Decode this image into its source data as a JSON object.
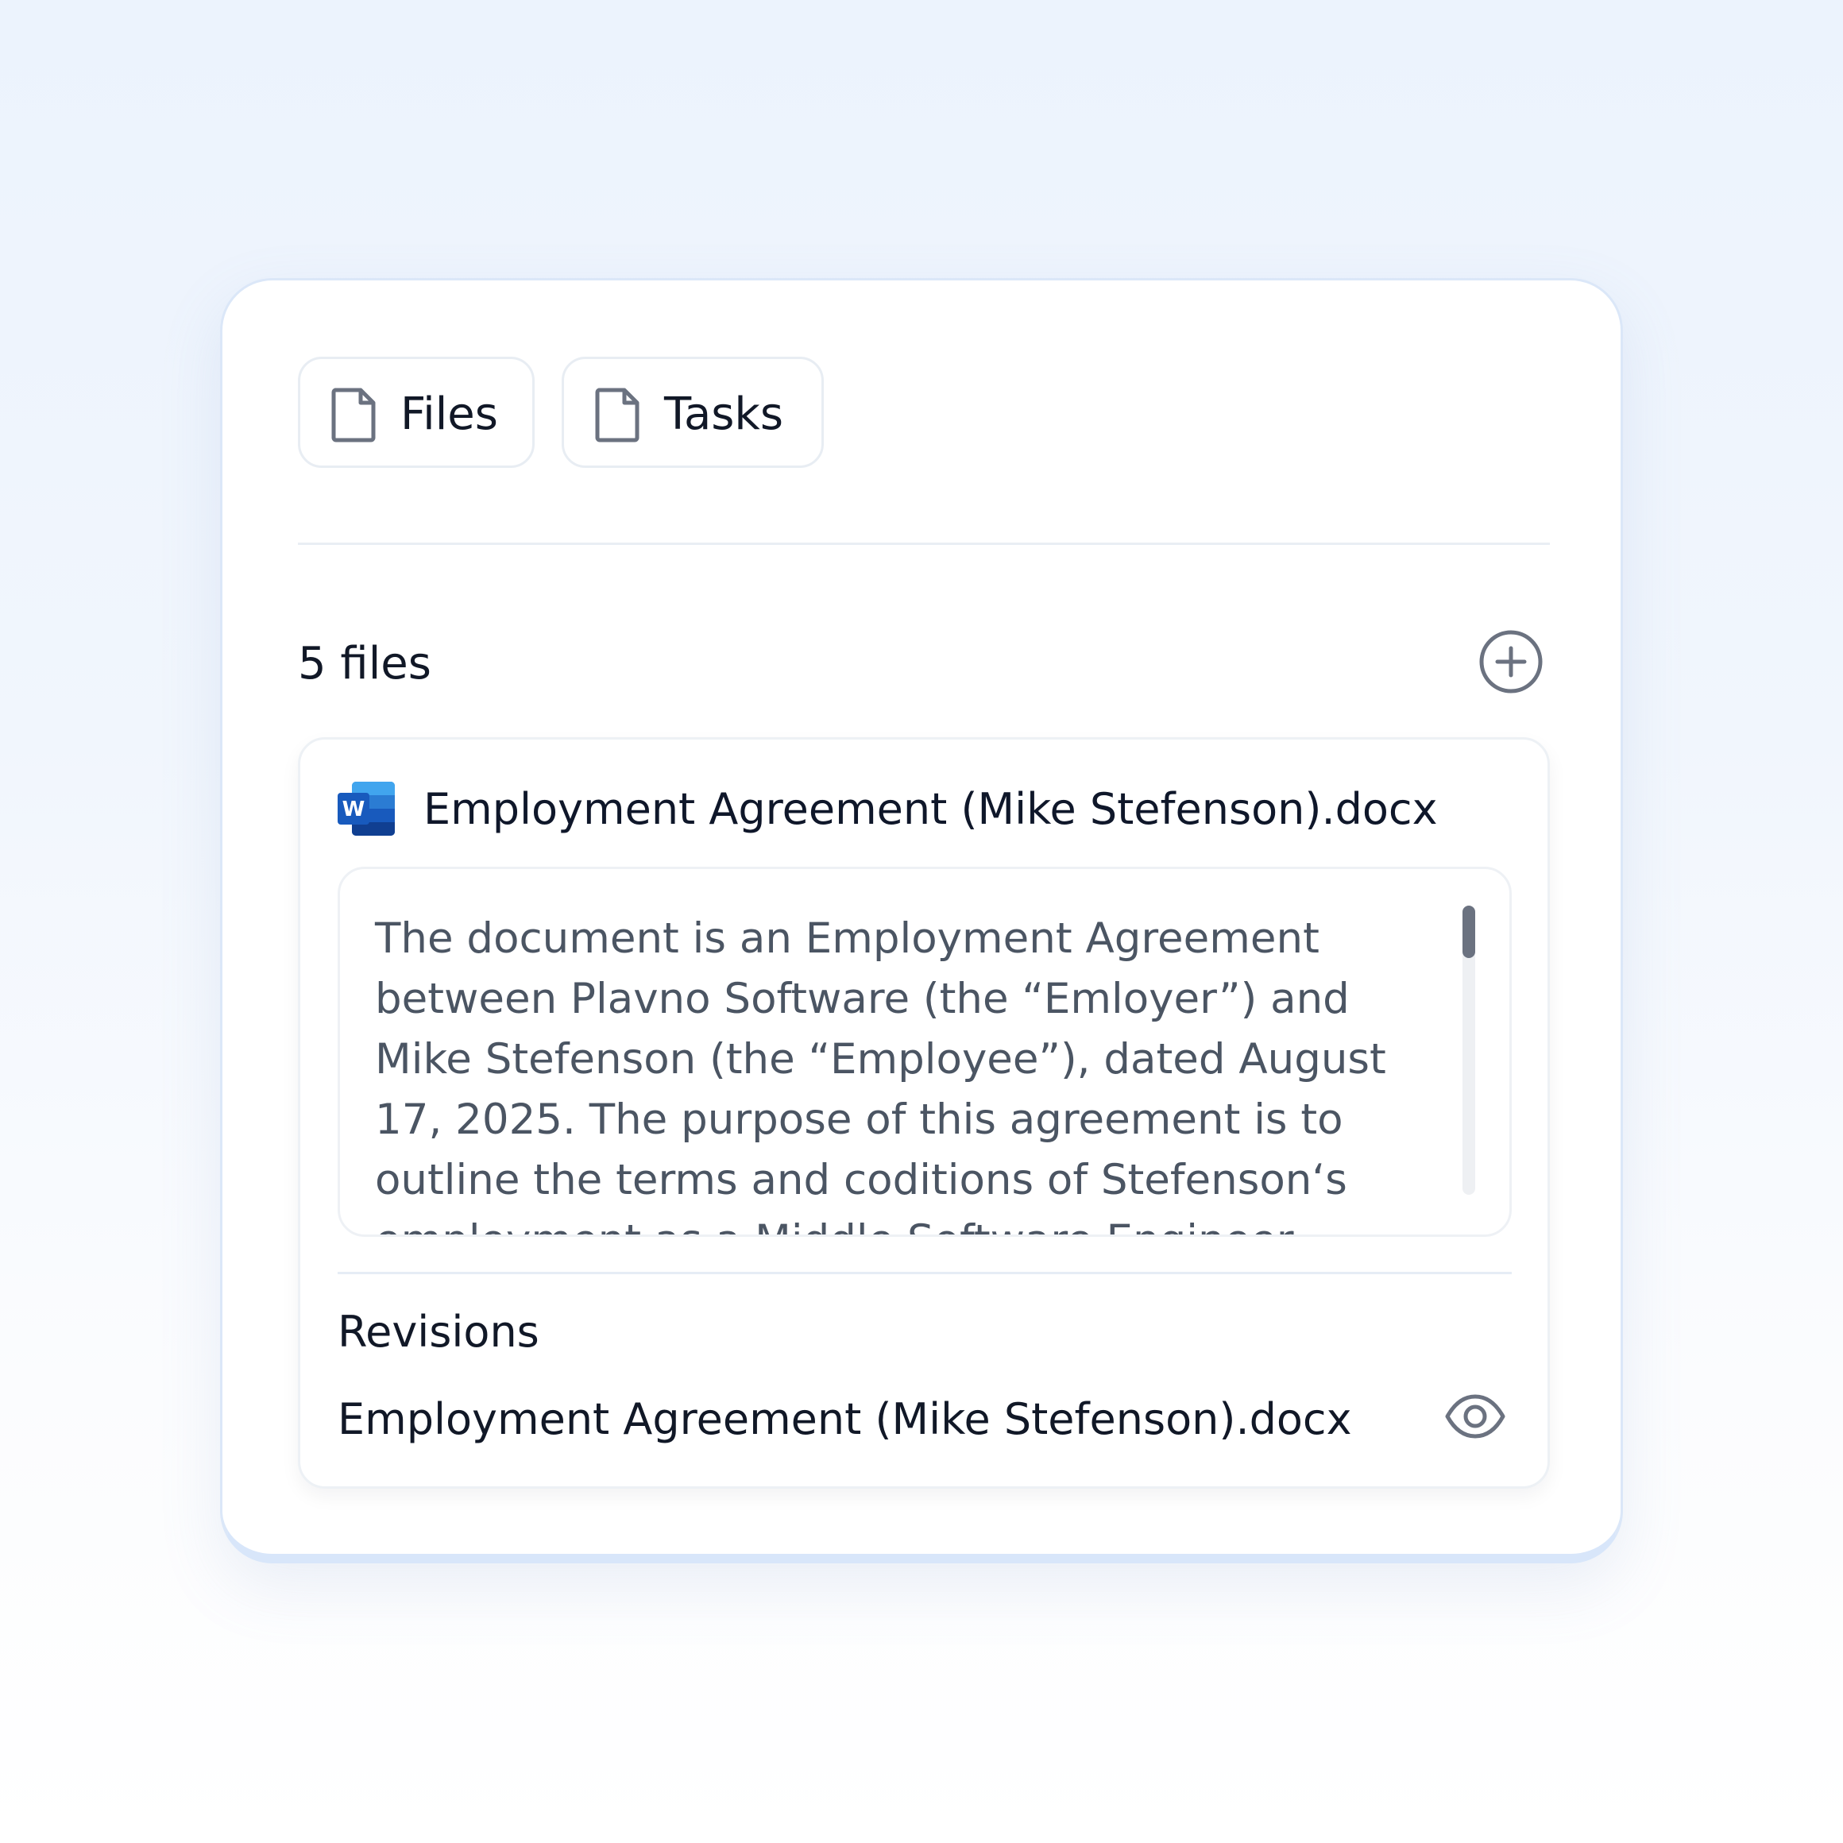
{
  "tabs": [
    {
      "label": "Files",
      "icon": "file-icon"
    },
    {
      "label": "Tasks",
      "icon": "file-icon"
    }
  ],
  "files_section": {
    "count_label": "5 files",
    "add_icon": "plus-circle-icon"
  },
  "file": {
    "icon": "word-doc-icon",
    "icon_letter": "W",
    "name": "Employment Agreement (Mike Stefenson).docx",
    "summary": "The document is an Employment Agreement between Plavno Software (the “Emloyer”) and Mike Stefenson (the “Employee”), dated August 17, 2025. The purpose of this agreement is to outline the terms and coditions of Stefenson‘s employment as a Middle Software Engineer"
  },
  "revisions": {
    "title": "Revisions",
    "items": [
      {
        "name": "Employment Agreement (Mike Stefenson).docx",
        "action_icon": "eye-icon"
      }
    ]
  },
  "colors": {
    "card_border": "#dbe7f8",
    "text_primary": "#0f172a",
    "text_secondary": "#4b5563",
    "icon_gray": "#6b7280",
    "word_blue": "#185abd"
  }
}
